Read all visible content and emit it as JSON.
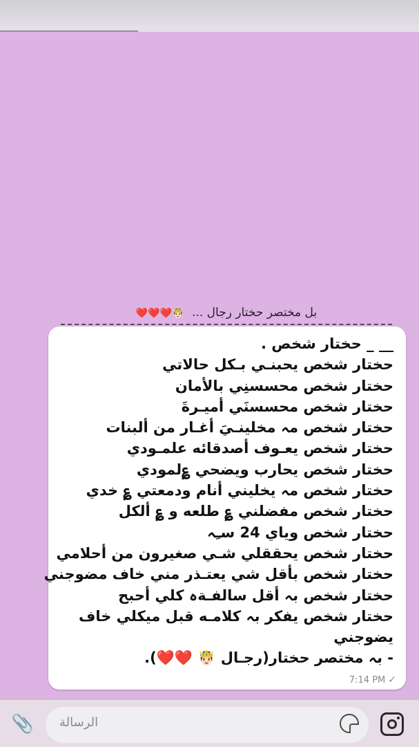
{
  "header": {
    "text": "بل مختصر حختار رجال ...",
    "emoji": "🤴🏻❤️❤️❤️"
  },
  "message": {
    "lines": [
      "__ _ حختار شخص .",
      "حختار شخص يحبنـي بـكل حالاتي",
      "حختار شخص محسسنِي بالأمان",
      "حختار شخص محسسنَي أميـرةَ",
      "حختار شخص مہ مخلينـيَ أغـار من ألبنات",
      "حختار شخص يعـوف أصدقائه علمـودي",
      "حختار  شخص يحارب ويضحي ؏لمودي",
      "حختار  شخص مہ يخليني أنام ودمعتي ؏ خدي",
      "حختار شخص مفضلني ؏ طلعه و ؏ ألكل",
      "حختار شخص وياي 24 سـِہ",
      "حختار شخص يحققلي شـي صغيرون من أحلامي",
      "حختار شخص بأقل شي يعتـذر مني خاف مضوجني",
      "حختار شخص بہ أقل سالفـةہ كلي أحبح",
      "حختار شخص يفكر بہ كلامـه قبل ميكلي خاف",
      "يضوجني",
      "- بہ مختصر حختار(رجـال 🤴🏻 ❤️❤️)."
    ],
    "time": "7:14 PM",
    "status_icon": "single-check-icon"
  },
  "composer": {
    "placeholder": "الرسالة"
  },
  "colors": {
    "background": "#ddb3e3",
    "bubble": "#ffffff",
    "composer_bar": "#e6dde7"
  }
}
